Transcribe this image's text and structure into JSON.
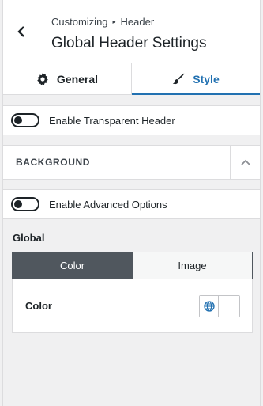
{
  "header": {
    "breadcrumb_root": "Customizing",
    "breadcrumb_separator": "▸",
    "breadcrumb_current": "Header",
    "title": "Global Header Settings",
    "back_icon": "chevron-left-icon"
  },
  "tabs": [
    {
      "label": "General",
      "icon": "gear-icon",
      "active": false
    },
    {
      "label": "Style",
      "icon": "paintbrush-icon",
      "active": true
    }
  ],
  "options": {
    "transparent_header": {
      "label": "Enable Transparent Header",
      "enabled": false
    },
    "advanced_options": {
      "label": "Enable Advanced Options",
      "enabled": false
    }
  },
  "section": {
    "title": "BACKGROUND",
    "collapse_icon": "chevron-up-icon",
    "expanded": true
  },
  "background": {
    "group_label": "Global",
    "segments": [
      {
        "label": "Color",
        "active": true
      },
      {
        "label": "Image",
        "active": false
      }
    ],
    "color_label": "Color",
    "globe_icon": "globe-icon",
    "swatch_color": "#ffffff"
  },
  "colors": {
    "accent": "#2271b1",
    "segment_active": "#50575e"
  }
}
